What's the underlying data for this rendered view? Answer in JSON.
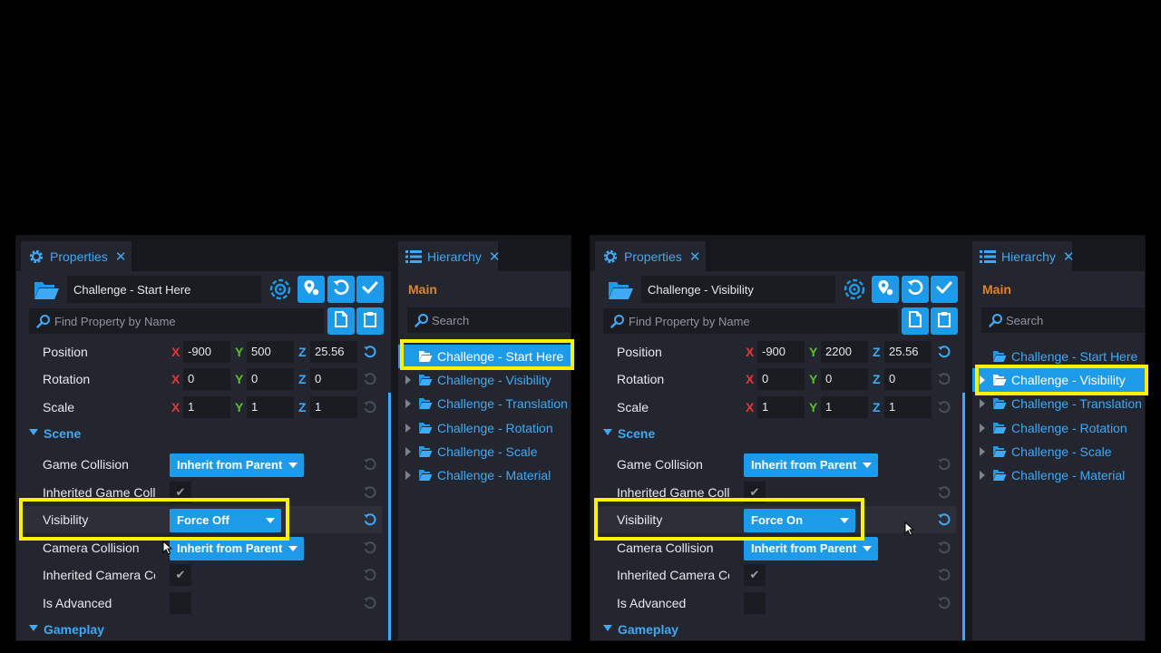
{
  "colors": {
    "accent": "#1e9be8",
    "highlight": "#fff200",
    "section": "#3fa9f5",
    "main_label": "#e2822a"
  },
  "left": {
    "properties_tab": "Properties",
    "hierarchy_tab": "Hierarchy",
    "tab_close": "✕",
    "object_name": "Challenge - Start Here",
    "find_placeholder": "Find Property by Name",
    "position": {
      "label": "Position",
      "x": "-900",
      "y": "500",
      "z": "25.56"
    },
    "rotation": {
      "label": "Rotation",
      "x": "0",
      "y": "0",
      "z": "0"
    },
    "scale": {
      "label": "Scale",
      "x": "1",
      "y": "1",
      "z": "1"
    },
    "axis": {
      "x": "X",
      "y": "Y",
      "z": "Z"
    },
    "scene_section": "Scene",
    "game_collision": {
      "label": "Game Collision",
      "value": "Inherit from Parent"
    },
    "inherited_game_collision": {
      "label": "Inherited Game Coll",
      "check": "✔"
    },
    "visibility": {
      "label": "Visibility",
      "value": "Force Off"
    },
    "camera_collision": {
      "label": "Camera Collision",
      "value": "Inherit from Parent"
    },
    "inherited_camera": {
      "label": "Inherited Camera Co",
      "check": "✔"
    },
    "is_advanced": {
      "label": "Is Advanced"
    },
    "gameplay_section": "Gameplay",
    "hierarchy": {
      "main": "Main",
      "search_placeholder": "Search",
      "items": [
        "Challenge - Start Here",
        "Challenge - Visibility",
        "Challenge - Translation",
        "Challenge - Rotation",
        "Challenge - Scale",
        "Challenge - Material"
      ]
    }
  },
  "right": {
    "properties_tab": "Properties",
    "hierarchy_tab": "Hierarchy",
    "tab_close": "✕",
    "object_name": "Challenge - Visibility",
    "find_placeholder": "Find Property by Name",
    "position": {
      "label": "Position",
      "x": "-900",
      "y": "2200",
      "z": "25.56"
    },
    "rotation": {
      "label": "Rotation",
      "x": "0",
      "y": "0",
      "z": "0"
    },
    "scale": {
      "label": "Scale",
      "x": "1",
      "y": "1",
      "z": "1"
    },
    "axis": {
      "x": "X",
      "y": "Y",
      "z": "Z"
    },
    "scene_section": "Scene",
    "game_collision": {
      "label": "Game Collision",
      "value": "Inherit from Parent"
    },
    "inherited_game_collision": {
      "label": "Inherited Game Coll",
      "check": "✔"
    },
    "visibility": {
      "label": "Visibility",
      "value": "Force On"
    },
    "camera_collision": {
      "label": "Camera Collision",
      "value": "Inherit from Parent"
    },
    "inherited_camera": {
      "label": "Inherited Camera Co",
      "check": "✔"
    },
    "is_advanced": {
      "label": "Is Advanced"
    },
    "gameplay_section": "Gameplay",
    "hierarchy": {
      "main": "Main",
      "search_placeholder": "Search",
      "items": [
        "Challenge - Start Here",
        "Challenge - Visibility",
        "Challenge - Translation",
        "Challenge - Rotation",
        "Challenge - Scale",
        "Challenge - Material"
      ]
    }
  }
}
